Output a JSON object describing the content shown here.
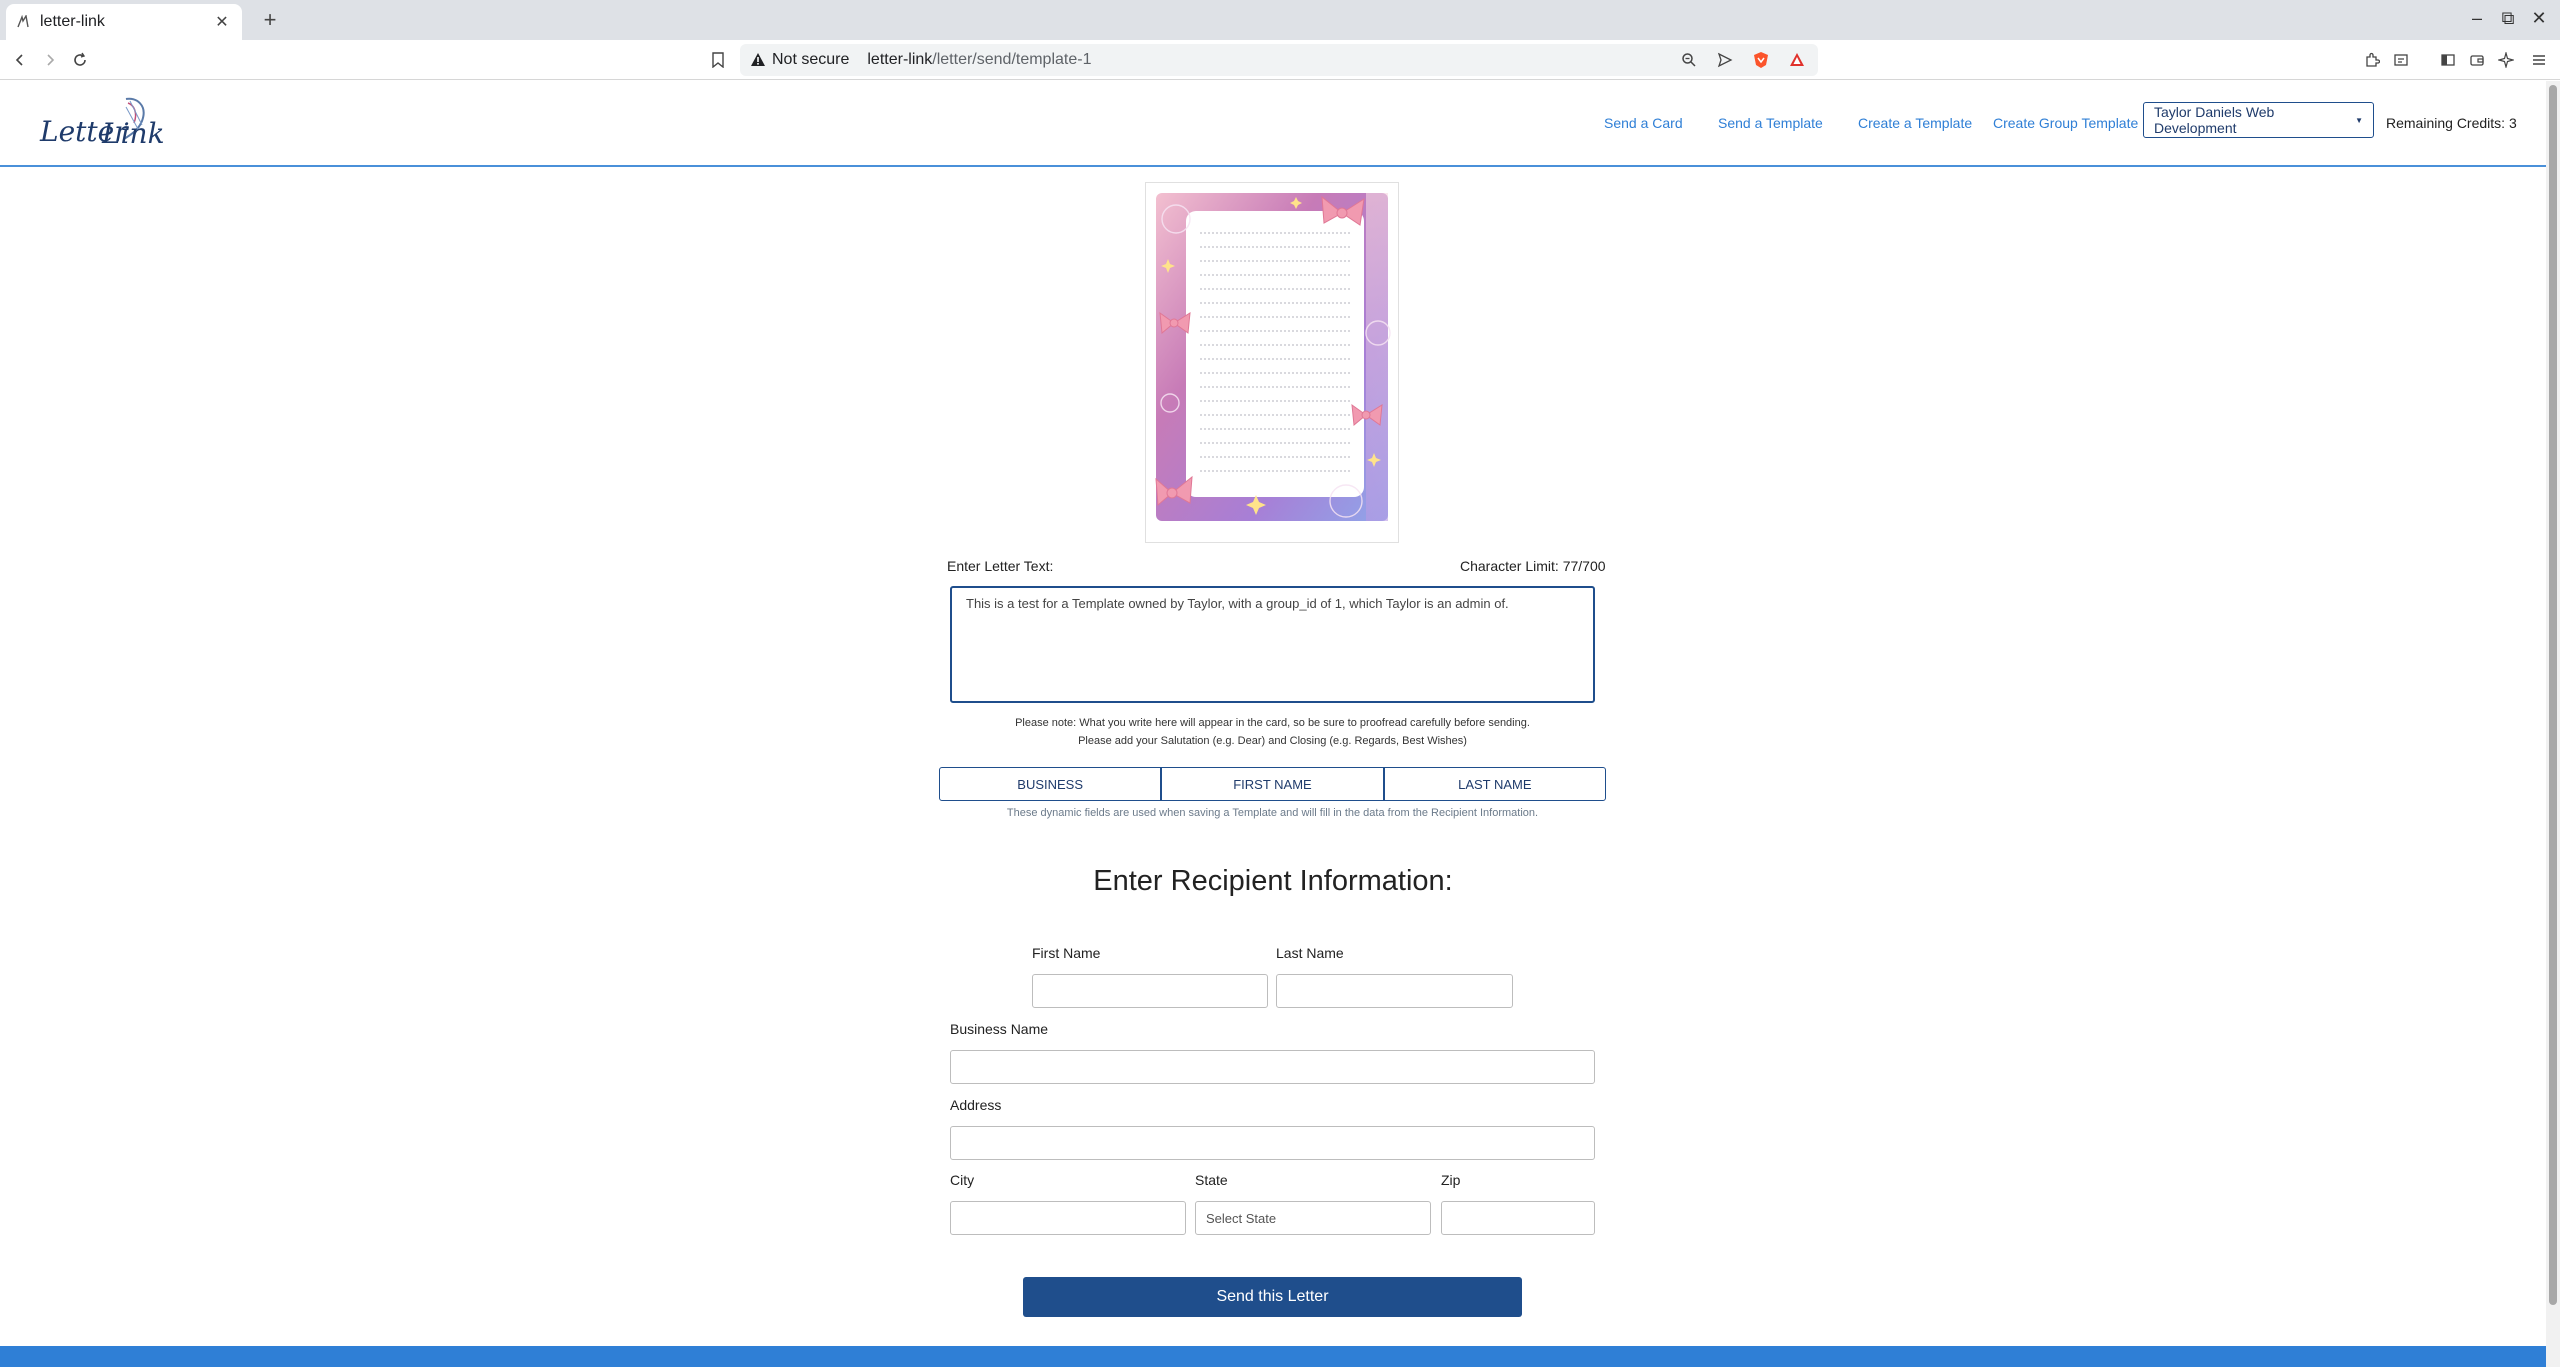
{
  "browser": {
    "tab_title": "letter-link",
    "new_tab": "+",
    "not_secure": "Not secure",
    "url_host": "letter-link",
    "url_path": "/letter/send/template-1",
    "window_controls": [
      "–",
      "⧉",
      "✕"
    ]
  },
  "site": {
    "logo_text": "Letter Link",
    "nav": {
      "send_card": "Send a Card",
      "send_template": "Send a Template",
      "create_template": "Create a Template",
      "create_group_template": "Create Group Template"
    },
    "group_dropdown": "Taylor Daniels Web Development",
    "credits": "Remaining Credits: 3"
  },
  "letter": {
    "label": "Enter Letter Text:",
    "char_limit": "Character Limit: 77/700",
    "text": "This is a test for a Template owned by Taylor, with a group_id of 1, which Taylor is an admin of.",
    "note_line1": "Please note: What you write here will appear in the card, so be sure to proofread carefully before sending.",
    "note_line2": "Please add your Salutation (e.g. Dear) and Closing (e.g. Regards, Best Wishes)"
  },
  "dynamic_fields": {
    "buttons": [
      "BUSINESS",
      "FIRST NAME",
      "LAST NAME"
    ],
    "help": "These dynamic fields are used when saving a Template and will fill in the data from the Recipient Information."
  },
  "recipient": {
    "title": "Enter Recipient Information:",
    "first_name_label": "First Name",
    "last_name_label": "Last Name",
    "business_label": "Business Name",
    "address_label": "Address",
    "city_label": "City",
    "state_label": "State",
    "state_placeholder": "Select State",
    "zip_label": "Zip"
  },
  "submit_label": "Send this Letter",
  "colors": {
    "primary": "#1f4e8c",
    "link": "#2f7fd6"
  }
}
